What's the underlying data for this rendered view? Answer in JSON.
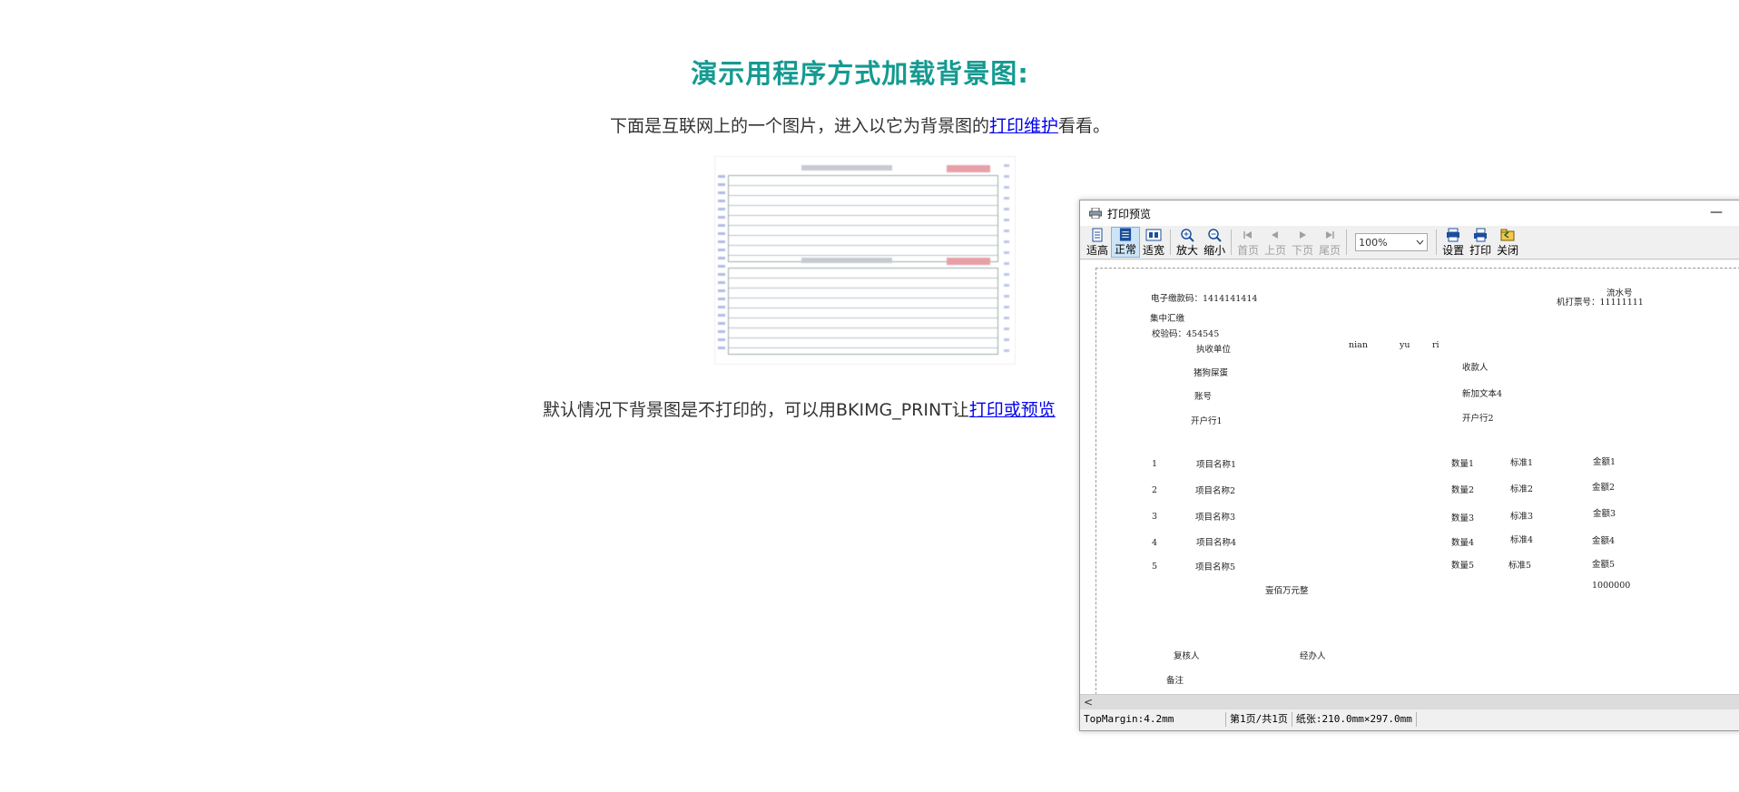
{
  "heading": "演示用程序方式加载背景图:",
  "intro": {
    "before": "下面是互联网上的一个图片，进入以它为背景图的",
    "link": "打印维护",
    "after": "看看。"
  },
  "note": {
    "before": "默认情况下背景图是不打印的，可以用BKIMG_PRINT让",
    "link": "打印或预览"
  },
  "preview_window": {
    "title": "打印预览",
    "minimize": "—",
    "toolbar": {
      "fit_height": "适高",
      "normal": "正常",
      "fit_width": "适宽",
      "zoom_in": "放大",
      "zoom_out": "缩小",
      "first_page": "首页",
      "prev_page": "上页",
      "next_page": "下页",
      "last_page": "尾页",
      "zoom_value": "100%",
      "setup": "设置",
      "print": "打印",
      "close": "关闭"
    },
    "document": {
      "e_payment_code": "电子缴款码：1414141414",
      "serial_label": "流水号",
      "machine_ticket": "机打票号：11111111",
      "centralized": "集中汇缴",
      "check_code": "校验码：454545",
      "executing_unit": "执收单位",
      "date_parts": [
        "nian",
        "yu",
        "ri"
      ],
      "payer_name": "猪狗屎蛋",
      "payee": "收款人",
      "account": "账号",
      "extra_text4": "新加文本4",
      "bank1": "开户行1",
      "bank2": "开户行2",
      "rows": [
        {
          "no": "1",
          "item": "项目名称1",
          "qty": "数量1",
          "std": "标准1",
          "amount": "金额1"
        },
        {
          "no": "2",
          "item": "项目名称2",
          "qty": "数量2",
          "std": "标准2",
          "amount": "金额2"
        },
        {
          "no": "3",
          "item": "项目名称3",
          "qty": "数量3",
          "std": "标准3",
          "amount": "金额3"
        },
        {
          "no": "4",
          "item": "项目名称4",
          "qty": "数量4",
          "std": "标准4",
          "amount": "金额4"
        },
        {
          "no": "5",
          "item": "项目名称5",
          "qty": "数量5",
          "std": "标准5",
          "amount": "金额5"
        }
      ],
      "total_words": "壹佰万元整",
      "total_amount": "1000000",
      "reviewer": "复核人",
      "handler": "经办人",
      "remarks": "备注"
    },
    "status": {
      "top_margin": "TopMargin:4.2mm",
      "page": "第1页/共1页",
      "paper": "纸张:210.0mm×297.0mm"
    },
    "scroll_left": "<"
  }
}
